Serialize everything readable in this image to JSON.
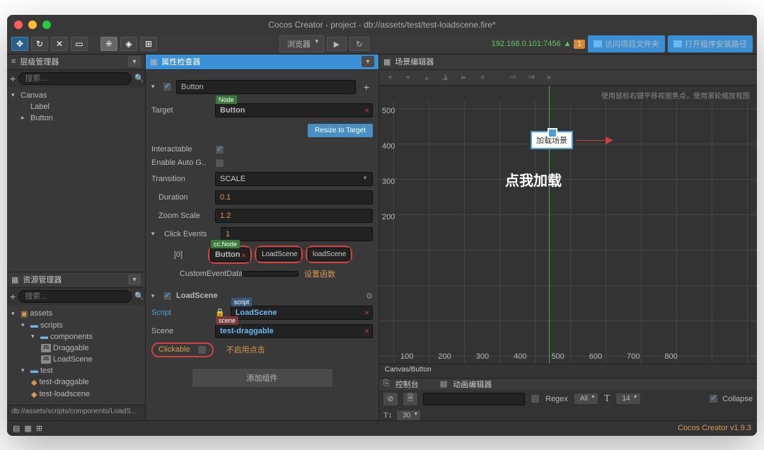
{
  "titlebar": {
    "title": "Cocos Creator - project - db://assets/test/test-loadscene.fire*"
  },
  "toolbar": {
    "browser_label": "浏览器",
    "ip": "192.168.0.101:7456",
    "badge": "1",
    "visit_folder": "访问项目文件夹",
    "open_installer": "打开程序安装路径"
  },
  "hierarchy": {
    "title": "层级管理器",
    "search_placeholder": "搜索...",
    "items": {
      "canvas": "Canvas",
      "label": "Label",
      "button": "Button"
    }
  },
  "assets": {
    "title": "资源管理器",
    "search_placeholder": "搜索...",
    "root": "assets",
    "scripts": "scripts",
    "components": "components",
    "draggable": "Draggable",
    "loadscene": "LoadScene",
    "test": "test",
    "test_draggable": "test-draggable",
    "test_loadscene": "test-loadscene",
    "path": "db://assets/scripts/components/LoadS..."
  },
  "inspector": {
    "title": "属性检查器",
    "button_name": "Button",
    "target_label": "Target",
    "target_value": "Button",
    "node_tag": "Node",
    "resize_btn": "Resize to Target",
    "interactable": "Interactable",
    "enable_auto": "Enable Auto G..",
    "transition": "Transition",
    "transition_val": "SCALE",
    "duration": "Duration",
    "duration_val": "0.1",
    "zoom": "Zoom Scale",
    "zoom_val": "1.2",
    "click_events": "Click Events",
    "click_events_val": "1",
    "event_idx": "[0]",
    "event_node": "Button",
    "event_comp": "LoadScene",
    "event_handler": "loadScene",
    "custom_data": "CustomEventData",
    "set_func": "设置函数",
    "loadscene_hdr": "LoadScene",
    "script_label": "Script",
    "script_tag": "script",
    "script_val": "LoadScene",
    "scene_label": "Scene",
    "scene_tag": "scene",
    "scene_val": "test-draggable",
    "clickable": "Clickable",
    "no_click": "不启用点击",
    "add_comp": "添加组件"
  },
  "scene": {
    "title": "场景编辑器",
    "hint": "使用鼠标右键平移视窗焦点，使用滚轮缩放视图",
    "btn_text": "加载场景",
    "center_text": "点我加载",
    "breadcrumb": "Canvas/Button",
    "ruler_v": [
      "500",
      "400",
      "300",
      "200"
    ],
    "ruler_h": [
      "100",
      "200",
      "300",
      "400",
      "500",
      "600",
      "700",
      "800"
    ]
  },
  "console": {
    "tab1": "控制台",
    "tab2": "动画编辑器",
    "regex": "Regex",
    "all": "All",
    "font_size": "14",
    "line_h": "30",
    "collapse": "Collapse"
  },
  "status": {
    "version": "Cocos Creator v1.9.3"
  }
}
